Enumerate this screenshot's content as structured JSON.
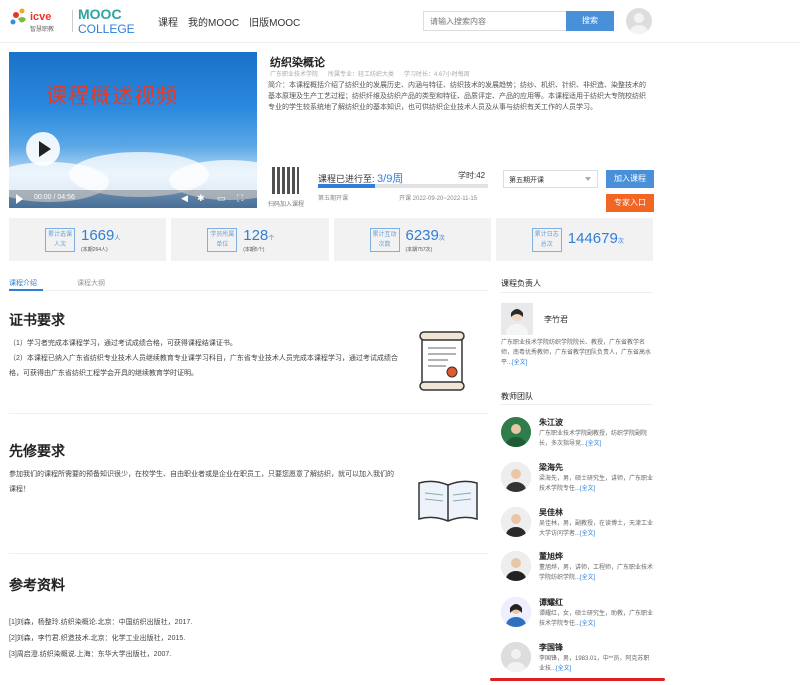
{
  "header": {
    "logo_icve_text": "icve",
    "logo_icve_sub": "智慧职教",
    "logo_mooc_text": "MOOC",
    "logo_college_text": "COLLEGE",
    "nav": [
      "课程",
      "我的MOOC",
      "旧版MOOC"
    ],
    "search_placeholder": "请输入搜索内容",
    "search_button": "搜索"
  },
  "video": {
    "overlay_title": "课程概述视频",
    "time": "00:00 / 04:56"
  },
  "course": {
    "title": "纺织染概论",
    "meta": [
      "广东职业技术学院",
      "所属专业：轻工纺织大类",
      "学习时长：4.67小时每周"
    ],
    "intro": "简介：本课程概括介绍了纺织业的发展历史、内涵与特征、纺织技术的发展趋势；纺纱、机织、针织、非织造、染整技术的基本原理及生产工艺过程；纺织纤维及纺织产品的类型和特征、品质评定、产品的应用等。本课程适用于纺织大专院校纺织专业的学生较系统地了解纺织业的基本知识，也可供纺织企业技术人员及从事与纺织有关工作的人员学习。",
    "qr_label": "扫码加入课程",
    "progress_prefix": "课程已进行至:",
    "progress_value": "3/9周",
    "progress_fraction": 0.333,
    "hours": "学时:42",
    "status": "第五期开课",
    "dates": "开课 2022-09-20~2022-11-15",
    "select_value": "第五期开课",
    "join_button": "加入课程",
    "expert_button": "专家入口"
  },
  "stats": [
    {
      "label": "累计选课人次",
      "value": "1669",
      "unit": "人",
      "sub": "(本期264人)"
    },
    {
      "label": "学员所属单位",
      "value": "128",
      "unit": "个",
      "sub": "(本期5个)"
    },
    {
      "label": "累计互动次数",
      "value": "6239",
      "unit": "次",
      "sub": "(本期757次)"
    },
    {
      "label": "累计日志总次",
      "value": "144679",
      "unit": "次",
      "sub": ""
    }
  ],
  "tabs": [
    "课程介绍",
    "课程大纲"
  ],
  "sections": {
    "cert_title": "证书要求",
    "cert_p1": "（1）学习者完成本课程学习，通过考试成绩合格，可获得课程结课证书。",
    "cert_p2": "（2）本课程已纳入广东省纺织专业技术人员继续教育专业课学习科目，广东省专业技术人员完成本课程学习，通过考试成绩合格，可获得由广东省纺织工程学会开具的继续教育学时证明。",
    "pre_title": "先修要求",
    "pre_p": "参加我们的课程所需要的预备知识很少，在校学生、自由职业者或是企业在职员工，只要您愿意了解纺织，就可以加入我们的课程！",
    "ref_title": "参考资料",
    "refs": [
      "[1]刘森，杨整玲.纺织染概论.北京：中国纺织出版社，2017.",
      "[2]刘森，李竹君.织造技术.北京：化学工业出版社，2015.",
      "[3]周启澄.纺织染概说.上海：东华大学出版社，2007."
    ]
  },
  "sidebar": {
    "leader_title": "课程负责人",
    "leader_name": "李竹君",
    "leader_desc": "广东职业技术学院纺织学院院长、教授，广东省教学名师，南粤优秀教师，广东省教学团队负责人，广东省高水平...",
    "more": "[全文]",
    "team_title": "教师团队",
    "teachers": [
      {
        "name": "朱江波",
        "desc": "广东职业技术学院副教授，纺织学院副院长，多次指导竞..."
      },
      {
        "name": "梁海先",
        "desc": "梁海先，男，硕士研究生，讲师，广东职业技术学院专任..."
      },
      {
        "name": "吴佳林",
        "desc": "吴佳林，男，副教授，在读博士，天津工业大学访问学者..."
      },
      {
        "name": "董旭烨",
        "desc": "董旭烨，男，讲师，工程师，广东职业技术学院纺织学院..."
      },
      {
        "name": "谭耀红",
        "desc": "谭耀红，女，硕士研究生，助教，广东职业技术学院专任..."
      },
      {
        "name": "李国锋",
        "desc": "李国锋，男，1983.01，中**员，阿克苏职业技..."
      }
    ]
  }
}
